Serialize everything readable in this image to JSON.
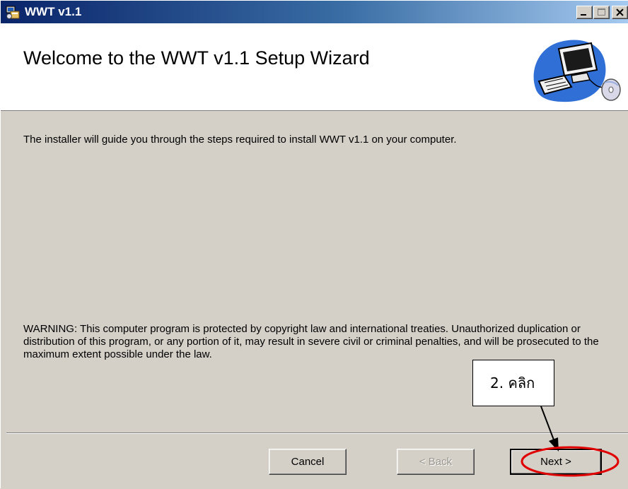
{
  "window": {
    "title": "WWT v1.1",
    "titlebar_buttons": [
      "minimize-icon",
      "maximize-icon",
      "close-icon"
    ]
  },
  "banner": {
    "title": "Welcome to the WWT v1.1 Setup Wizard",
    "art_icon": "computer-cd-icon"
  },
  "body": {
    "intro": "The installer will guide you through the steps required to install WWT v1.1 on your computer.",
    "warning": "WARNING: This computer program is protected by copyright law and international treaties. Unauthorized duplication or distribution of this program, or any portion of it, may result in severe civil or criminal penalties, and will be prosecuted to the maximum extent possible under the law."
  },
  "buttons": {
    "cancel": "Cancel",
    "back": "< Back",
    "next": "Next >"
  },
  "annotation": {
    "callout": "2. คลิก",
    "highlight_color": "#e00000"
  },
  "colors": {
    "titlebar_start": "#0a246a",
    "titlebar_end": "#a6caf0",
    "dialog_bg": "#d4d0c8"
  }
}
